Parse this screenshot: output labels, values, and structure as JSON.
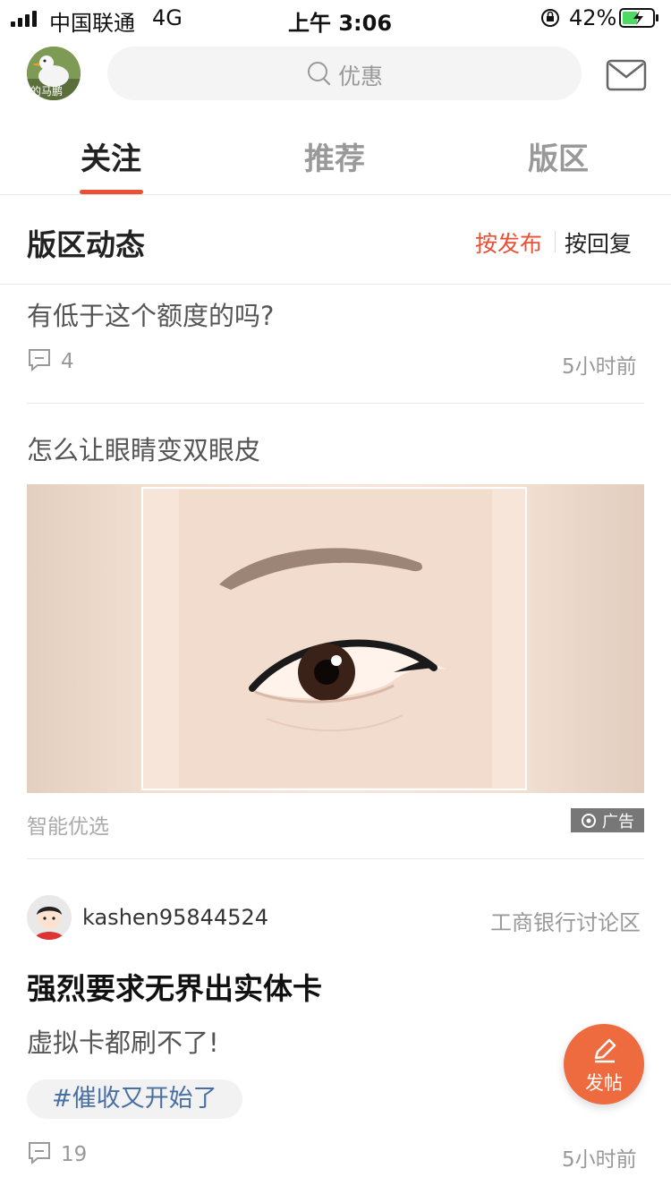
{
  "status_bar": {
    "carrier": "中国联通",
    "network": "4G",
    "time": "上午 3:06",
    "battery": "42%"
  },
  "header": {
    "avatar_caption": "的马鹏",
    "search_placeholder": "优惠",
    "mail_icon": "mail-icon"
  },
  "tabs": [
    {
      "label": "关注"
    },
    {
      "label": "推荐"
    },
    {
      "label": "版区"
    }
  ],
  "section": {
    "title": "版区动态",
    "sort_by_publish": "按发布",
    "sort_by_reply": "按回复"
  },
  "posts": [
    {
      "title": "有低于这个额度的吗?",
      "comments": "4",
      "time": "5小时前"
    }
  ],
  "ad": {
    "title": "怎么让眼睛变双眼皮",
    "source": "智能优选",
    "badge": "广告"
  },
  "post2": {
    "username": "kashen95844524",
    "board": "工商银行讨论区",
    "title": "强烈要求无界出实体卡",
    "body": "虚拟卡都刷不了!",
    "tag": "#催收又开始了",
    "comments": "19",
    "time": "5小时前"
  },
  "fab": {
    "label": "发帖"
  },
  "colors": {
    "accent": "#ea5035",
    "fab": "#ee6a3f",
    "tag_text": "#4a6fa5"
  }
}
